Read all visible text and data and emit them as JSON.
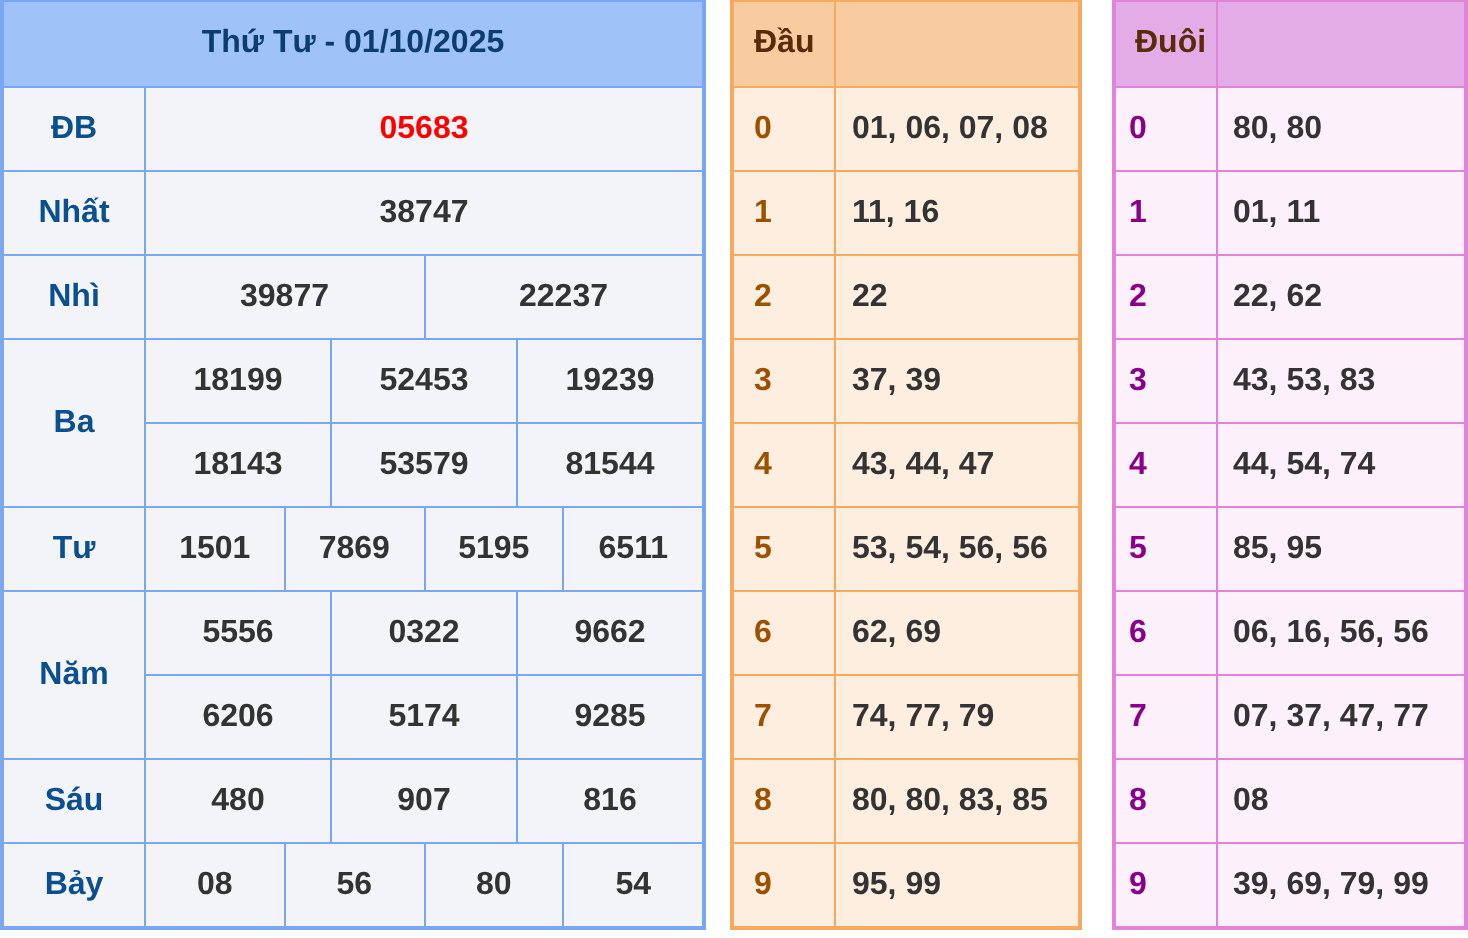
{
  "results": {
    "title": "Thứ Tư - 01/10/2025",
    "prizes": [
      {
        "label": "ĐB",
        "kind": "special",
        "rows": [
          [
            "05683"
          ]
        ]
      },
      {
        "label": "Nhất",
        "kind": "normal",
        "rows": [
          [
            "38747"
          ]
        ]
      },
      {
        "label": "Nhì",
        "kind": "normal",
        "rows": [
          [
            "39877",
            "22237"
          ]
        ]
      },
      {
        "label": "Ba",
        "kind": "normal",
        "rows": [
          [
            "18199",
            "52453",
            "19239"
          ],
          [
            "18143",
            "53579",
            "81544"
          ]
        ]
      },
      {
        "label": "Tư",
        "kind": "normal",
        "rows": [
          [
            "1501",
            "7869",
            "5195",
            "6511"
          ]
        ]
      },
      {
        "label": "Năm",
        "kind": "normal",
        "rows": [
          [
            "5556",
            "0322",
            "9662"
          ],
          [
            "6206",
            "5174",
            "9285"
          ]
        ]
      },
      {
        "label": "Sáu",
        "kind": "normal",
        "rows": [
          [
            "480",
            "907",
            "816"
          ]
        ]
      },
      {
        "label": "Bảy",
        "kind": "normal",
        "rows": [
          [
            "08",
            "56",
            "80",
            "54"
          ]
        ]
      }
    ]
  },
  "head_table": {
    "title": "Đầu",
    "rows": [
      {
        "digit": "0",
        "values": "01, 06, 07, 08"
      },
      {
        "digit": "1",
        "values": "11, 16"
      },
      {
        "digit": "2",
        "values": "22"
      },
      {
        "digit": "3",
        "values": "37, 39"
      },
      {
        "digit": "4",
        "values": "43, 44, 47"
      },
      {
        "digit": "5",
        "values": "53, 54, 56, 56"
      },
      {
        "digit": "6",
        "values": "62, 69"
      },
      {
        "digit": "7",
        "values": "74, 77, 79"
      },
      {
        "digit": "8",
        "values": "80, 80, 83, 85"
      },
      {
        "digit": "9",
        "values": "95, 99"
      }
    ]
  },
  "tail_table": {
    "title": "Đuôi",
    "rows": [
      {
        "digit": "0",
        "values": "80, 80"
      },
      {
        "digit": "1",
        "values": "01, 11"
      },
      {
        "digit": "2",
        "values": "22, 62"
      },
      {
        "digit": "3",
        "values": "43, 53, 83"
      },
      {
        "digit": "4",
        "values": "44, 54, 74"
      },
      {
        "digit": "5",
        "values": "85, 95"
      },
      {
        "digit": "6",
        "values": "06, 16, 56, 56"
      },
      {
        "digit": "7",
        "values": "07, 37, 47, 77"
      },
      {
        "digit": "8",
        "values": "08"
      },
      {
        "digit": "9",
        "values": "39, 69, 79, 99"
      }
    ]
  }
}
